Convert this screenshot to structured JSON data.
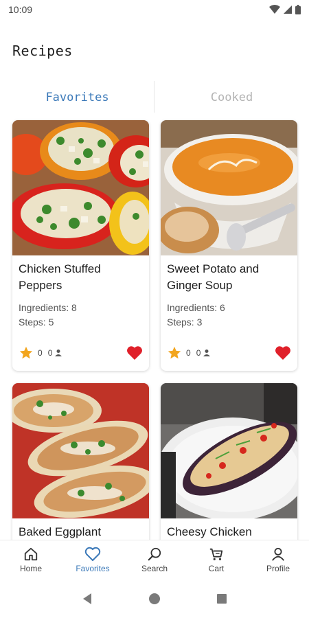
{
  "status_bar": {
    "time": "10:09",
    "icons": [
      "wifi-icon",
      "signal-icon",
      "battery-icon"
    ]
  },
  "page": {
    "title": "Recipes"
  },
  "tabs": [
    {
      "label": "Favorites",
      "active": true
    },
    {
      "label": "Cooked",
      "active": false
    }
  ],
  "recipes": [
    {
      "title": "Chicken Stuffed Peppers",
      "ingredients": "Ingredients: 8",
      "steps": "Steps: 5",
      "rating": "0",
      "cooks": "0",
      "favorite": true
    },
    {
      "title": "Sweet Potato and Ginger Soup",
      "ingredients": "Ingredients: 6",
      "steps": "Steps: 3",
      "rating": "0",
      "cooks": "0",
      "favorite": true
    },
    {
      "title": "Baked Eggplant"
    },
    {
      "title": "Cheesy Chicken"
    }
  ],
  "bottom_nav": [
    {
      "label": "Home",
      "icon": "home-icon",
      "active": false
    },
    {
      "label": "Favorites",
      "icon": "heart-outline-icon",
      "active": true
    },
    {
      "label": "Search",
      "icon": "search-icon",
      "active": false
    },
    {
      "label": "Cart",
      "icon": "cart-icon",
      "active": false
    },
    {
      "label": "Profile",
      "icon": "person-icon",
      "active": false
    }
  ],
  "system_nav": [
    "back-icon",
    "home-circle-icon",
    "recents-icon"
  ],
  "colors": {
    "accent": "#3a78b8",
    "heart": "#e0202a",
    "star": "#f2a51e",
    "inactive_tab": "#b3b3b3"
  }
}
